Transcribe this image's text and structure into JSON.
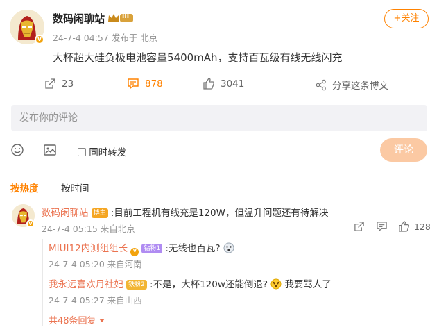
{
  "post": {
    "author": "数码闲聊站",
    "level_badge": "III",
    "timestamp": "24-7-4 04:57",
    "location": "发布于 北京",
    "text": "大杯超大硅负极电池容量5400mAh，支持百瓦级有线无线闪充",
    "follow_label": "+关注"
  },
  "actions": {
    "repost_count": "23",
    "comment_count": "878",
    "like_count": "3041",
    "share_label": "分享这条博文"
  },
  "composer": {
    "placeholder": "发布你的评论",
    "repost_label": "同时转发",
    "submit_label": "评论"
  },
  "sort_tabs": {
    "hot": "按热度",
    "time": "按时间"
  },
  "comment": {
    "author": "数码闲聊站",
    "author_tag": "博主",
    "text": ":目前工程机有线充是120W，但温升问题还有待解决",
    "meta": "24-7-4 05:15 来自北京",
    "like_count": "128",
    "replies": [
      {
        "author": "MIUI12内测组组长",
        "tag": "钻粉1",
        "text": ":无线也百瓦?",
        "meta": "24-7-4 05:20 来自河南"
      },
      {
        "author": "我永远喜欢月社妃",
        "tag": "铁粉2",
        "text": ":不是，大杯120w还能倒退?",
        "text_after_emoji": "我要骂人了",
        "meta": "24-7-4 05:27 来自山西"
      }
    ],
    "more_replies": "共48条回复"
  },
  "colors": {
    "accent": "#ff8200",
    "name": "#eb7350",
    "meta": "#939393",
    "submit_disabled": "#fbc9a3",
    "input_bg": "#f2f2f5"
  },
  "icons": [
    "repost-icon",
    "comment-icon",
    "like-icon",
    "share-icon",
    "emoji-icon",
    "image-icon",
    "checkbox-icon",
    "verified-icon",
    "chevron-down-icon"
  ]
}
